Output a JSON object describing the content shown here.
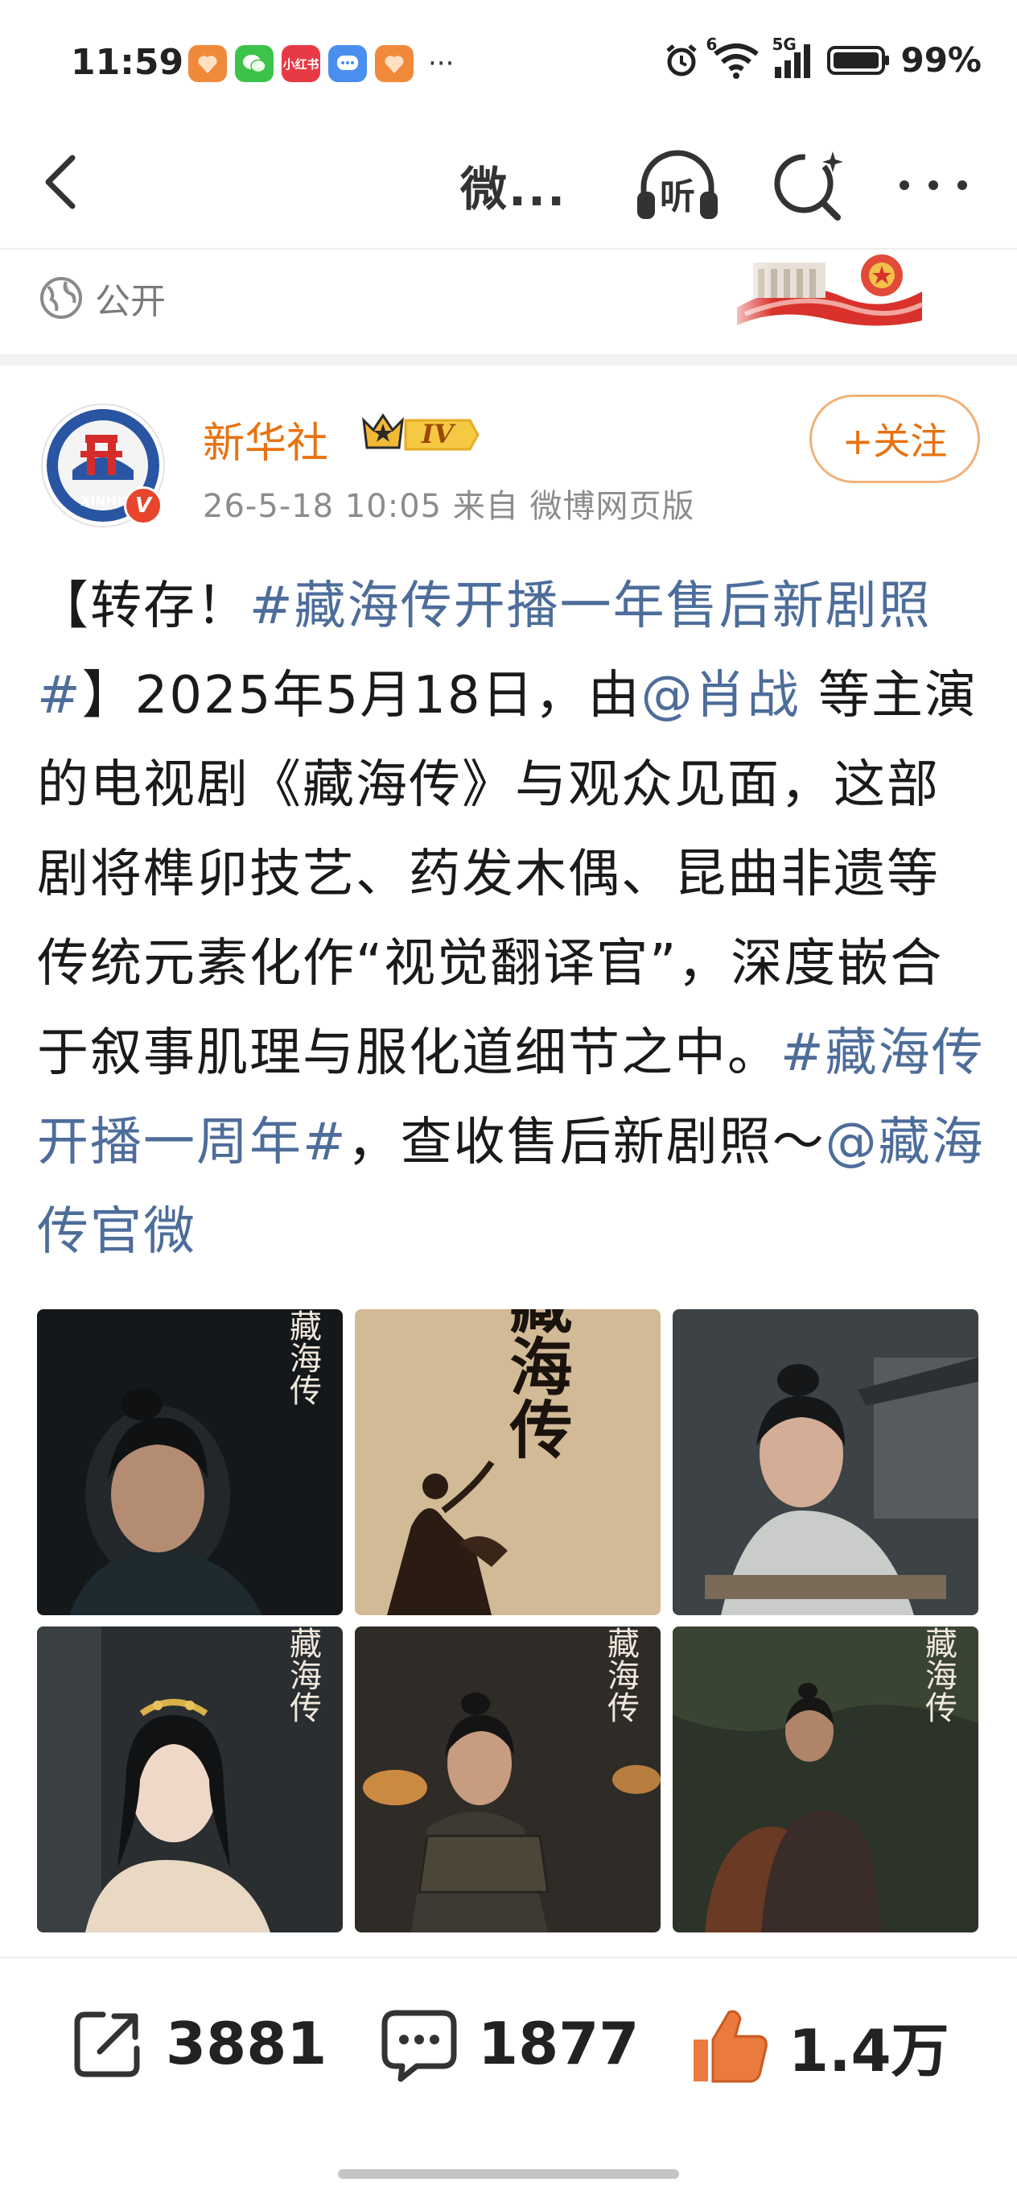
{
  "status_bar": {
    "time": "11:59",
    "apps": [
      {
        "icon": "heart-app-icon",
        "color": "#f08a3a",
        "label": ""
      },
      {
        "icon": "wechat-icon",
        "color": "#3cc34a",
        "label": ""
      },
      {
        "icon": "xiaohongshu-icon",
        "color": "#e83a45",
        "label": "小红书"
      },
      {
        "icon": "chat-bubble-app-icon",
        "color": "#4a8ff0",
        "label": ""
      },
      {
        "icon": "heart-app-icon",
        "color": "#f08a3a",
        "label": ""
      }
    ],
    "more": "···",
    "network_label": "5G",
    "wifi_label": "6",
    "battery_percent": "99%"
  },
  "nav": {
    "title": "微...",
    "listen_label": "听"
  },
  "visibility": {
    "label": "公开"
  },
  "author": {
    "name": "新华社",
    "level_badge": "IV",
    "verified_badge": "V",
    "avatar_text": "XINHUA",
    "meta": "26-5-18 10:05  来自 微博网页版",
    "follow_label": "+关注"
  },
  "post": {
    "seg1": "【转存！",
    "tag1": "#藏海传开播一年售后新剧照#",
    "seg2": "】2025年5月18日，由",
    "mention1": "@肖战",
    "seg3": " 等主演的电视剧《藏海传》与观众见面，这部剧将榫卯技艺、药发木偶、昆曲非遗等传统元素化作“视觉翻译官”，深度嵌合于叙事肌理与服化道细节之中。",
    "tag2": "#藏海传开播一周年#",
    "seg4": "，查收售后新剧照～",
    "mention2": "@藏海传官微"
  },
  "images": [
    {
      "title_text": "藏海传"
    },
    {
      "title_text": "藏海传"
    },
    {
      "title_text": ""
    },
    {
      "title_text": "藏海传"
    },
    {
      "title_text": "藏海传"
    },
    {
      "title_text": "藏海传"
    }
  ],
  "actions": {
    "repost_count": "3881",
    "comment_count": "1877",
    "like_count": "1.4万"
  },
  "colors": {
    "accent": "#e8720e",
    "link": "#4d6d9a",
    "meta": "#8c8c8c"
  }
}
